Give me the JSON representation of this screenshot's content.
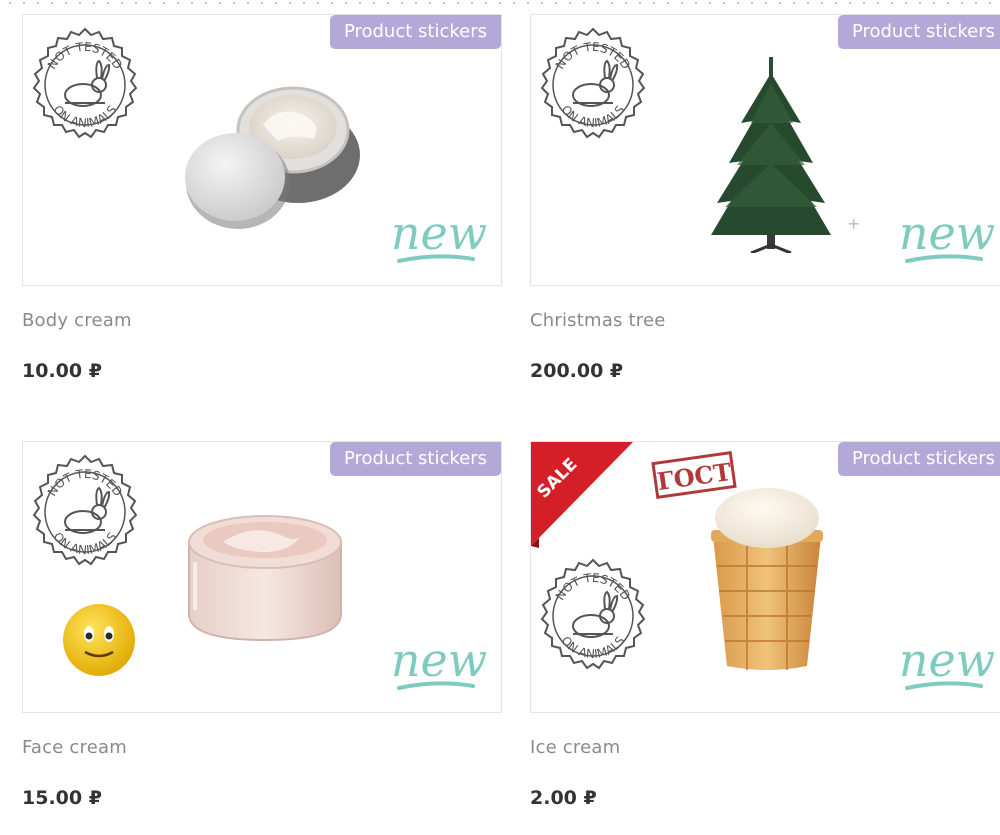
{
  "products": [
    {
      "name": "Body cream",
      "price": "10.00 ₽",
      "sticker": "Product stickers",
      "stamp_top": "NOT TESTED",
      "stamp_bottom": "ON ANIMALS",
      "new": "new"
    },
    {
      "name": "Christmas tree",
      "price": "200.00 ₽",
      "sticker": "Product stickers",
      "stamp_top": "NOT TESTED",
      "stamp_bottom": "ON ANIMALS",
      "new": "new"
    },
    {
      "name": "Face cream",
      "price": "15.00 ₽",
      "sticker": "Product stickers",
      "stamp_top": "NOT TESTED",
      "stamp_bottom": "ON ANIMALS",
      "new": "new"
    },
    {
      "name": "Ice cream",
      "price": "2.00 ₽",
      "sticker": "Product stickers",
      "stamp_top": "NOT TESTED",
      "stamp_bottom": "ON ANIMALS",
      "new": "new",
      "sale": "SALE",
      "gost": "ГОСТ"
    }
  ],
  "colors": {
    "sticker_bg": "#b3a8d8",
    "new_badge": "#7fcbbf",
    "sale_ribbon": "#d41f26",
    "gost_stamp": "#b03a3a",
    "stamp_gray": "#555555"
  }
}
